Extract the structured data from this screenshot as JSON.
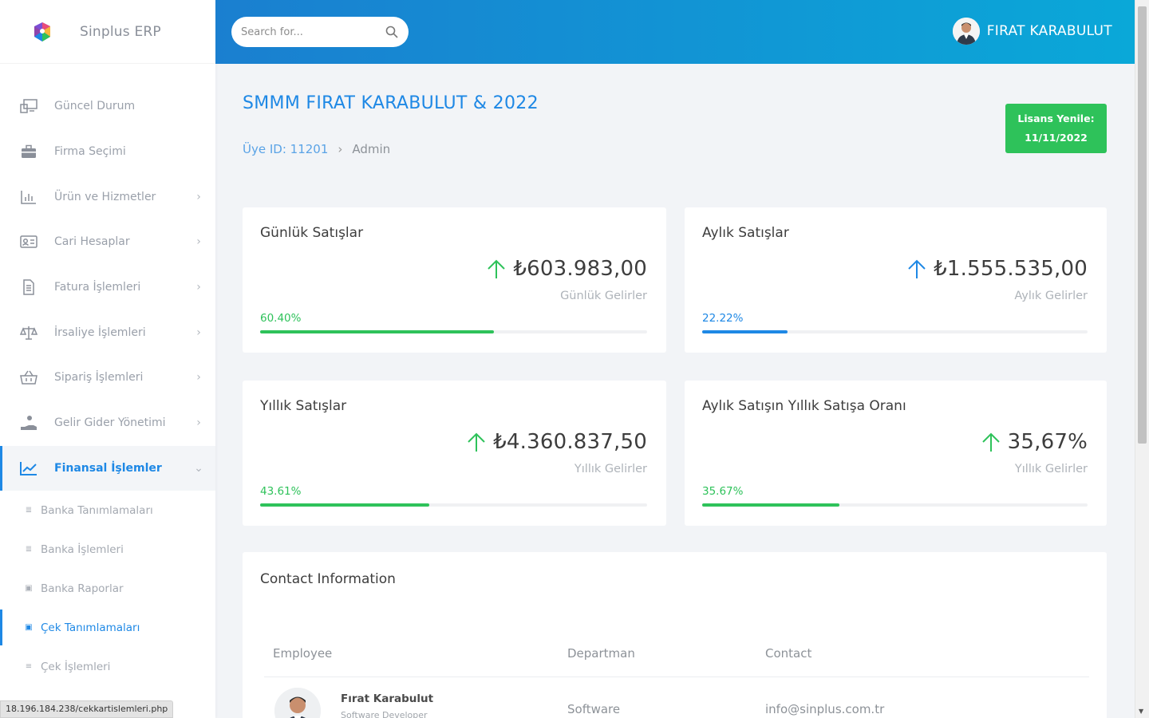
{
  "app": {
    "name": "Sinplus ERP"
  },
  "search": {
    "placeholder": "Search for..."
  },
  "user": {
    "name": "FIRAT KARABULUT"
  },
  "sidebar": {
    "items": [
      {
        "label": "Güncel Durum",
        "icon": "monitor-icon",
        "has_children": false
      },
      {
        "label": "Firma Seçimi",
        "icon": "briefcase-icon",
        "has_children": false
      },
      {
        "label": "Ürün ve Hizmetler",
        "icon": "bar-chart-icon",
        "has_children": true
      },
      {
        "label": "Cari Hesaplar",
        "icon": "id-card-icon",
        "has_children": true
      },
      {
        "label": "Fatura İşlemleri",
        "icon": "invoice-icon",
        "has_children": true
      },
      {
        "label": "İrsaliye İşlemleri",
        "icon": "scale-icon",
        "has_children": true
      },
      {
        "label": "Sipariş İşlemleri",
        "icon": "basket-icon",
        "has_children": true
      },
      {
        "label": "Gelir Gider Yönetimi",
        "icon": "hand-coins-icon",
        "has_children": true
      },
      {
        "label": "Finansal İşlemler",
        "icon": "line-chart-icon",
        "has_children": true,
        "active": true
      }
    ],
    "subitems": [
      {
        "label": "Banka Tanımlamaları"
      },
      {
        "label": "Banka İşlemleri"
      },
      {
        "label": "Banka Raporlar"
      },
      {
        "label": "Çek Tanımlamaları",
        "current": true
      },
      {
        "label": "Çek İşlemleri"
      }
    ]
  },
  "statusbar": {
    "url": "18.196.184.238/cekkartislemleri.php"
  },
  "page": {
    "title": "SMMM FIRAT KARABULUT & 2022",
    "breadcrumb": {
      "member": "Üye ID: 11201",
      "current": "Admin"
    },
    "license": {
      "line1": "Lisans Yenile:",
      "line2": "11/11/2022"
    }
  },
  "cards": [
    {
      "title": "Günlük Satışlar",
      "value": "₺603.983,00",
      "subtitle": "Günlük Gelirler",
      "percent_label": "60.40%",
      "percent": 60.4,
      "color": "#2ec25a"
    },
    {
      "title": "Aylık Satışlar",
      "value": "₺1.555.535,00",
      "subtitle": "Aylık Gelirler",
      "percent_label": "22.22%",
      "percent": 22.22,
      "color": "#1e88e5"
    },
    {
      "title": "Yıllık Satışlar",
      "value": "₺4.360.837,50",
      "subtitle": "Yıllık Gelirler",
      "percent_label": "43.61%",
      "percent": 43.61,
      "color": "#2ec25a"
    },
    {
      "title": "Aylık Satışın Yıllık Satışa Oranı",
      "value": "35,67%",
      "subtitle": "Yıllık Gelirler",
      "percent_label": "35.67%",
      "percent": 35.67,
      "color": "#2ec25a"
    }
  ],
  "contact": {
    "title": "Contact Information",
    "headers": {
      "employee": "Employee",
      "department": "Departman",
      "contact": "Contact"
    },
    "rows": [
      {
        "name": "Fırat Karabulut",
        "role": "Software Developer",
        "department": "Software",
        "email": "info@sinplus.com.tr"
      }
    ]
  }
}
